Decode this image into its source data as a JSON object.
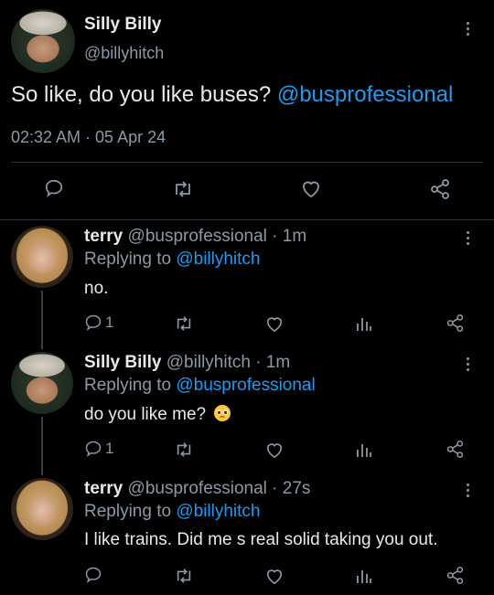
{
  "main_tweet": {
    "display_name": "Silly Billy",
    "handle": "@billyhitch",
    "text_prefix": "So like, do you like buses?",
    "mention": "@busprofessional",
    "timestamp": "02:32 AM · 05 Apr 24"
  },
  "replies": [
    {
      "display_name": "terry",
      "handle_time": "@busprofessional · 1m",
      "replying_prefix": "Replying to",
      "replying_to": "@billyhitch",
      "text": "no.",
      "reply_count": "1"
    },
    {
      "display_name": "Silly Billy",
      "handle_time": "@billyhitch · 1m",
      "replying_prefix": "Replying to",
      "replying_to": "@busprofessional",
      "text": "do you like me?",
      "reply_count": "1"
    },
    {
      "display_name": "terry",
      "handle_time": "@busprofessional · 27s",
      "replying_prefix": "Replying to",
      "replying_to": "@billyhitch",
      "text": "I like trains. Did me s real solid taking you out.",
      "reply_count": ""
    }
  ],
  "icons": [
    "reply-icon",
    "retweet-icon",
    "like-icon",
    "share-icon",
    "views-icon",
    "more-icon",
    "pleading-face-emoji"
  ],
  "colors": {
    "background": "#000000",
    "link": "#1d9bf0",
    "muted": "#8b98a5",
    "text": "#e7e9ea"
  }
}
